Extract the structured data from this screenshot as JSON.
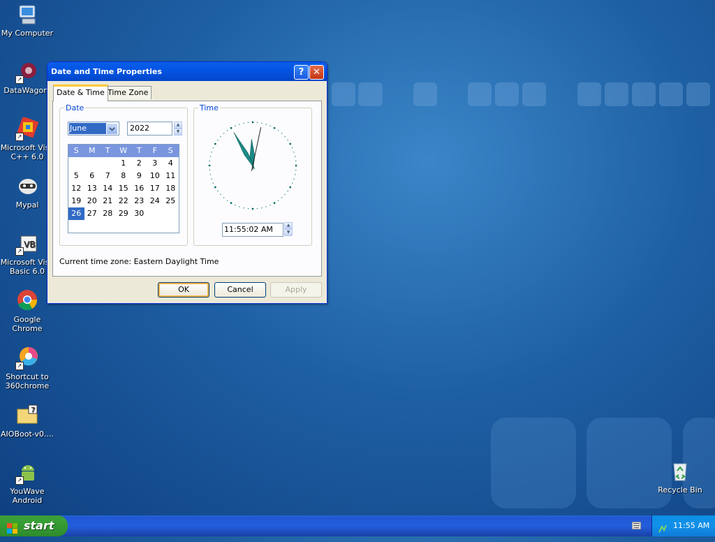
{
  "desktop": {
    "icons": [
      {
        "label": "My Computer"
      },
      {
        "label": "DataWagon."
      },
      {
        "label": "Microsoft Visu C++ 6.0"
      },
      {
        "label": "Mypal"
      },
      {
        "label": "Microsoft Visu Basic 6.0"
      },
      {
        "label": "Google Chrome"
      },
      {
        "label": "Shortcut to 360chrome"
      },
      {
        "label": "AIOBoot-v0...."
      },
      {
        "label": "YouWave Android"
      },
      {
        "label": "Recycle Bin"
      }
    ]
  },
  "dialog": {
    "title": "Date and Time Properties",
    "help_btn": "?",
    "close_btn": "✕",
    "tabs": [
      {
        "label": "Date & Time"
      },
      {
        "label": "Time Zone"
      }
    ],
    "date_group": "Date",
    "time_group": "Time",
    "month": "June",
    "year": "2022",
    "weekdays": [
      "S",
      "M",
      "T",
      "W",
      "T",
      "F",
      "S"
    ],
    "weeks": [
      [
        "",
        "",
        "",
        "1",
        "2",
        "3",
        "4"
      ],
      [
        "5",
        "6",
        "7",
        "8",
        "9",
        "10",
        "11"
      ],
      [
        "12",
        "13",
        "14",
        "15",
        "16",
        "17",
        "18"
      ],
      [
        "19",
        "20",
        "21",
        "22",
        "23",
        "24",
        "25"
      ],
      [
        "26",
        "27",
        "28",
        "29",
        "30",
        "",
        ""
      ]
    ],
    "selected_day": "26",
    "time_value": "11:55:02 AM",
    "clock": {
      "hour": 11,
      "minute": 55,
      "second": 2
    },
    "timezone_label": "Current time zone:  Eastern Daylight Time",
    "ok": "OK",
    "cancel": "Cancel",
    "apply": "Apply"
  },
  "taskbar": {
    "start": "start",
    "clock": "11:55 AM"
  }
}
